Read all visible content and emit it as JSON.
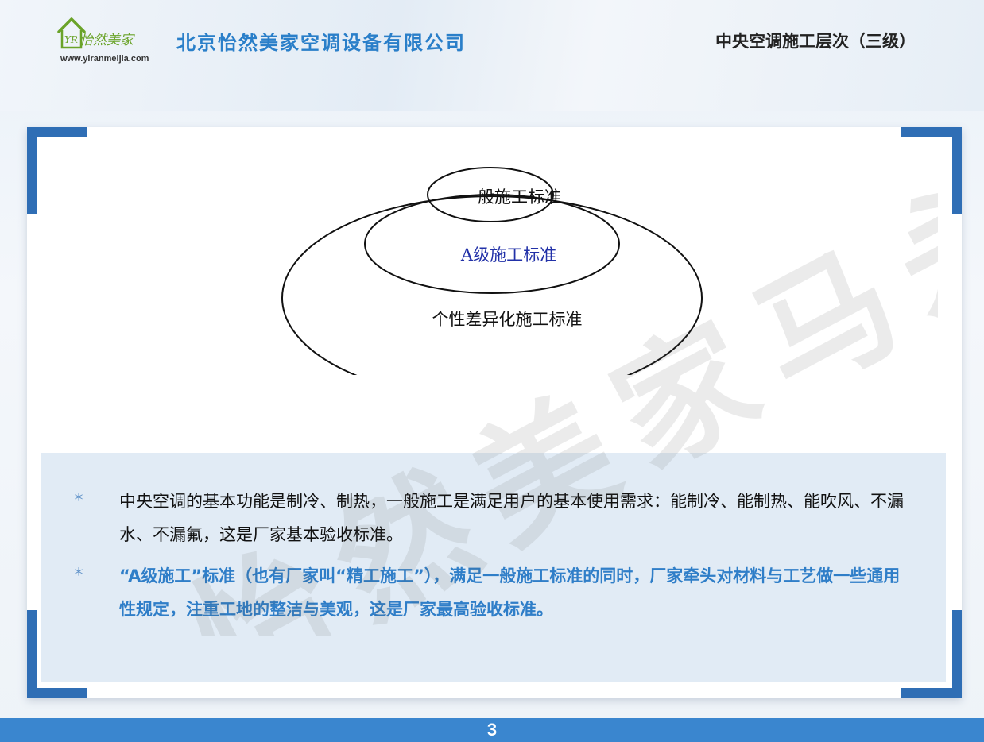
{
  "header": {
    "logo_script": "怡然美家",
    "logo_mark": "YR",
    "logo_url": "www.yiranmeijia.com",
    "company_name": "北京怡然美家空调设备有限公司",
    "slide_title": "中央空调施工层次（三级）"
  },
  "diagram": {
    "levels": [
      {
        "label": "一般施工标准",
        "color": "#111111"
      },
      {
        "label": "A级施工标准",
        "color": "#2231a8"
      },
      {
        "label": "个性差异化施工标准",
        "color": "#111111"
      }
    ]
  },
  "watermark": "怡然美家马永强",
  "bullets": [
    {
      "marker": "＊",
      "text": "中央空调的基本功能是制冷、制热，一般施工是满足用户的基本使用需求：能制冷、能制热、能吹风、不漏水、不漏氟，这是厂家基本验收标准。"
    },
    {
      "marker": "＊",
      "text": "“A级施工”标准（也有厂家叫“精工施工”），满足一般施工标准的同时，厂家牵头对材料与工艺做一些通用性规定，注重工地的整洁与美观，这是厂家最高验收标准。"
    }
  ],
  "footer": {
    "page_number": "3"
  },
  "colors": {
    "accent": "#2f6eb5",
    "brand_blue": "#2a7fc9",
    "highlight_text": "#2f7ec8",
    "footer_bar": "#3a86cf"
  }
}
